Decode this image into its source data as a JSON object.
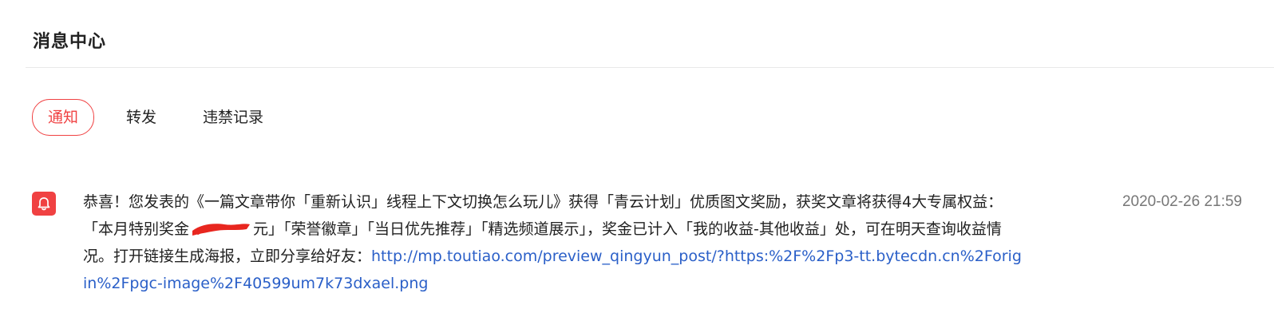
{
  "header": {
    "title": "消息中心"
  },
  "tabs": [
    {
      "label": "通知",
      "active": true
    },
    {
      "label": "转发",
      "active": false
    },
    {
      "label": "违禁记录",
      "active": false
    }
  ],
  "notification": {
    "icon": "bell-icon",
    "icon_color": "#f04142",
    "text_part1": "恭喜！您发表的《一篇文章带你「重新认识」线程上下文切换怎么玩儿》获得「青云计划」优质图文奖励，获奖文章将获得4大专属权益：「本月特别奖金",
    "text_part2": "元」「荣誉徽章」「当日优先推荐」「精选频道展示」，奖金已计入「我的收益-其他收益」处，可在明天查询收益情况。打开链接生成海报，立即分享给好友：",
    "link": "http://mp.toutiao.com/preview_qingyun_post/?https:%2F%2Fp3-tt.bytecdn.cn%2Forigin%2Fpgc-image%2F40599um7k73dxael.png",
    "time": "2020-02-26 21:59"
  },
  "colors": {
    "accent": "#f04142",
    "link": "#2a5fc8",
    "muted": "#777777"
  }
}
